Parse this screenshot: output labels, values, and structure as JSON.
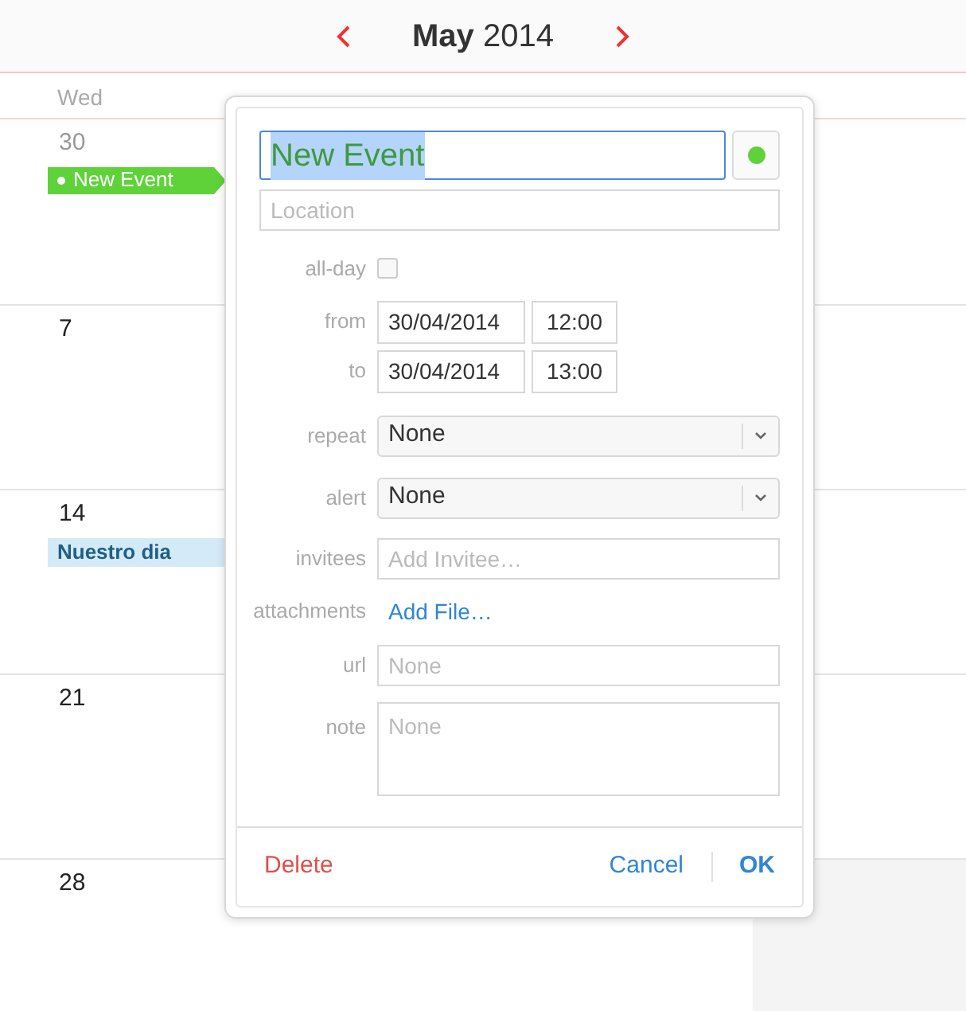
{
  "header": {
    "month": "May",
    "year": "2014"
  },
  "day_headers": [
    "Wed"
  ],
  "weeks": [
    {
      "date": "30",
      "events": [
        {
          "title": "New Event",
          "kind": "timed",
          "color": "#5fd23a"
        }
      ]
    },
    {
      "date": "7"
    },
    {
      "date": "14",
      "events": [
        {
          "title": "Nuestro dia",
          "kind": "all_day",
          "color": "#d4eaf6"
        }
      ]
    },
    {
      "date": "21"
    },
    {
      "date": "28"
    }
  ],
  "popup": {
    "title": "New Event",
    "title_selected": true,
    "color": "#5fd23a",
    "location_placeholder": "Location",
    "all_day": {
      "label": "all-day",
      "checked": false
    },
    "from": {
      "label": "from",
      "date": "30/04/2014",
      "time": "12:00"
    },
    "to": {
      "label": "to",
      "date": "30/04/2014",
      "time": "13:00"
    },
    "repeat": {
      "label": "repeat",
      "value": "None"
    },
    "alert": {
      "label": "alert",
      "value": "None"
    },
    "invitees": {
      "label": "invitees",
      "placeholder": "Add Invitee…"
    },
    "attachments": {
      "label": "attachments",
      "link": "Add File…"
    },
    "url": {
      "label": "url",
      "placeholder": "None"
    },
    "note": {
      "label": "note",
      "placeholder": "None"
    },
    "buttons": {
      "delete": "Delete",
      "cancel": "Cancel",
      "ok": "OK"
    }
  }
}
